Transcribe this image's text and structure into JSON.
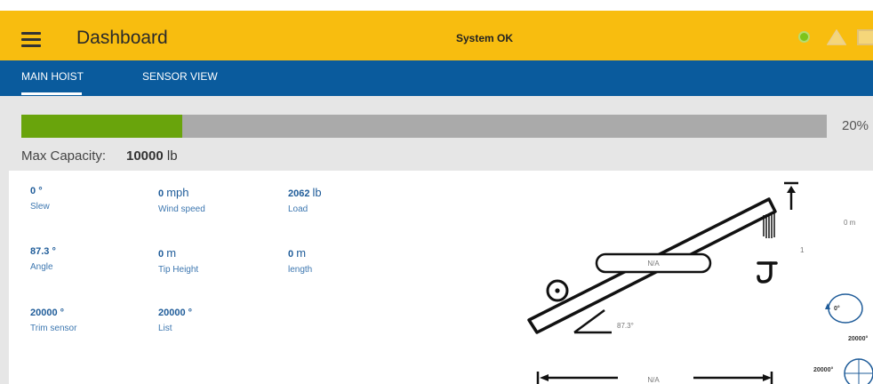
{
  "header": {
    "title": "Dashboard",
    "status": "System OK",
    "menu_icon": "hamburger-menu-icon"
  },
  "tabs": [
    {
      "label": "MAIN HOIST",
      "active": true
    },
    {
      "label": "SENSOR VIEW",
      "active": false
    }
  ],
  "capacity": {
    "percent_text": "20%",
    "fill_fraction": 0.2,
    "max_label": "Max Capacity:",
    "max_value": "10000",
    "max_unit": "lb"
  },
  "metrics": {
    "slew": {
      "value": "0",
      "unit": "°",
      "label": "Slew"
    },
    "wind": {
      "value": "0",
      "unit": "mph",
      "label": "Wind speed"
    },
    "load": {
      "value": "2062",
      "unit": "lb",
      "label": "Load"
    },
    "angle": {
      "value": "87.3",
      "unit": "°",
      "label": "Angle"
    },
    "tip_height": {
      "value": "0",
      "unit": "m",
      "label": "Tip Height"
    },
    "length": {
      "value": "0",
      "unit": "m",
      "label": "length"
    },
    "trim": {
      "value": "20000",
      "unit": "°",
      "label": "Trim sensor"
    },
    "list": {
      "value": "20000",
      "unit": "°",
      "label": "List"
    }
  },
  "diagram": {
    "boom_label": "N/A",
    "angle_label": "87.3°",
    "height_label": "0 m",
    "radius_label": "N/A",
    "side_mark": "1",
    "slew_label": "0°",
    "trim_label": "20000°",
    "list_label": "20000°"
  },
  "colors": {
    "topbar": "#f8bd0f",
    "tabbar": "#0a5b9d",
    "progress_fill": "#69a40c",
    "progress_track": "#aaaaaa",
    "status_ok": "#7ec41a"
  }
}
